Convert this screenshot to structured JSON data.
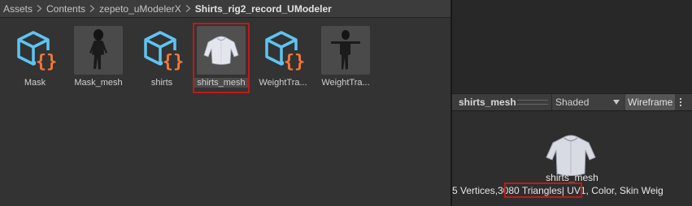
{
  "breadcrumb": {
    "items": [
      "Assets",
      "Contents",
      "zepeto_uModelerX",
      "Shirts_rig2_record_UModeler"
    ]
  },
  "assets": [
    {
      "name": "Mask",
      "icon": "prefab-icon"
    },
    {
      "name": "Mask_mesh",
      "icon": "figure-mesh-preview"
    },
    {
      "name": "shirts",
      "icon": "prefab-icon"
    },
    {
      "name": "shirts_mesh",
      "icon": "shirt-mesh-preview",
      "selected": true
    },
    {
      "name": "WeightTra...",
      "icon": "prefab-icon"
    },
    {
      "name": "WeightTra...",
      "icon": "t-pose-mesh-preview"
    }
  ],
  "inspector": {
    "title": "shirts_mesh",
    "shading_mode": "Shaded",
    "wireframe_label": "Wireframe",
    "preview_name": "shirts_mesh",
    "stats_prefix": "5 Vertices, ",
    "stats_triangles": "3080 Triangles",
    "stats_suffix": " | UV1, Color, Skin Weig"
  },
  "colors": {
    "prefab_blue": "#5fc4f2",
    "prefab_orange": "#f2763c",
    "highlight_red": "#c0191b"
  }
}
